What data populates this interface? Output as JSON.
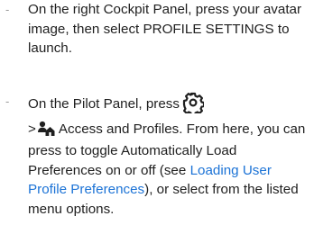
{
  "steps": [
    {
      "bullet": "-",
      "text": "On the right Cockpit Panel, press your avatar image, then select PROFILE SETTINGS to launch."
    },
    {
      "bullet": "-",
      "text_before_icon": "On the Pilot Panel, press",
      "icon": "gear-icon",
      "line2_prefix": ">",
      "icon2": "people-icon",
      "text_after_icon": "Access and Profiles. From here, you can press to toggle Automatically Load Preferences on or off (see",
      "link_text": "Loading User Profile Preferences",
      "text_end": "), or select from the listed menu options."
    }
  ],
  "colors": {
    "text": "#1f1f1f",
    "link": "#1c73d6",
    "bullet": "#9a9a9a"
  }
}
